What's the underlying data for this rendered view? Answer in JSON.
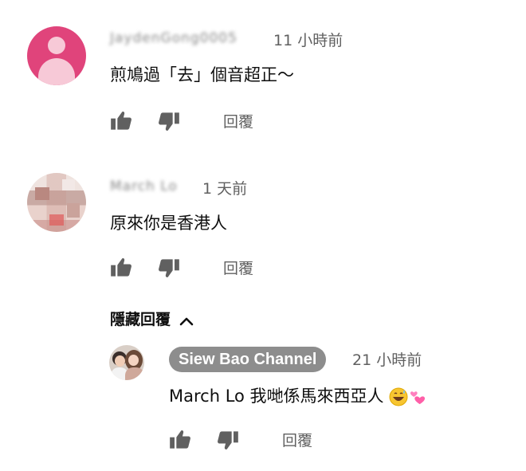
{
  "comments": [
    {
      "author": "JaydenGong0005",
      "time": "11 小時前",
      "text": "煎鳩過「去」個音超正～",
      "reply_label": "回覆"
    },
    {
      "author": "March Lo",
      "time": "1 天前",
      "text": "原來你是香港人",
      "reply_label": "回覆"
    }
  ],
  "hide_replies_label": "隱藏回覆",
  "reply": {
    "author": "Siew Bao Channel",
    "time": "21 小時前",
    "text": "March Lo 我哋係馬來西亞人",
    "reply_label": "回覆"
  },
  "icons": {
    "like": "thumbs-up-icon",
    "dislike": "thumbs-down-icon",
    "chevron": "chevron-up-icon",
    "emoji1": "grinning-sweat-emoji",
    "emoji2": "two-hearts-emoji"
  },
  "colors": {
    "pink_avatar": "#e0447b",
    "badge_bg": "#8d8d8d",
    "secondary_text": "#606060"
  }
}
